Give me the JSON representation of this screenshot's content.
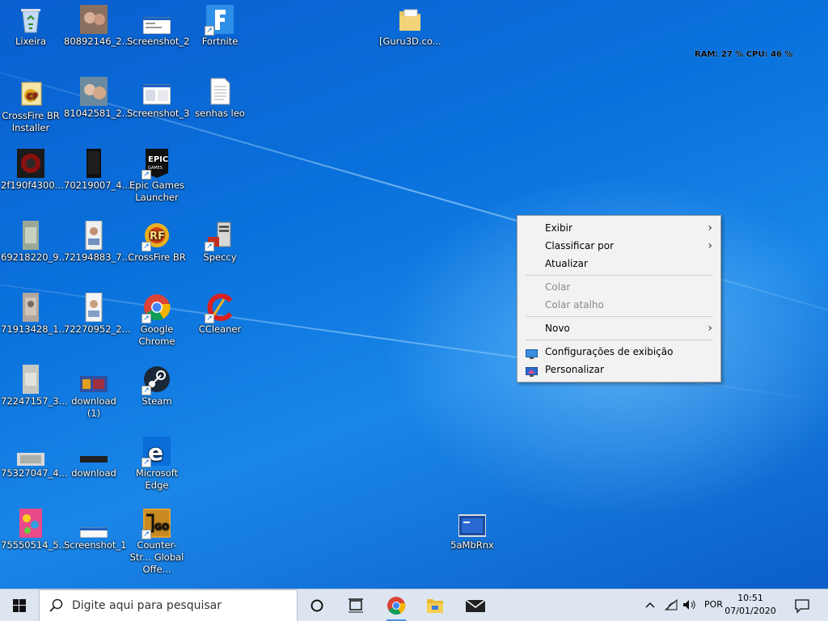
{
  "desktop_icons": [
    {
      "label": "Lixeira",
      "icon": "recycle-bin-icon"
    },
    {
      "label": "80892146_2...",
      "icon": "photo-thumbnail-icon"
    },
    {
      "label": "Screenshot_2",
      "icon": "image-file-icon"
    },
    {
      "label": "Fortnite",
      "icon": "fortnite-icon"
    },
    {
      "label": "[Guru3D.co...",
      "icon": "folder-icon"
    },
    {
      "label": "CrossFire BR Installer",
      "icon": "crossfire-installer-icon"
    },
    {
      "label": "81042581_2...",
      "icon": "photo-thumbnail-icon"
    },
    {
      "label": "Screenshot_3",
      "icon": "image-file-icon"
    },
    {
      "label": "senhas leo",
      "icon": "text-file-icon"
    },
    {
      "label": "2f190f4300...",
      "icon": "photo-thumbnail-icon"
    },
    {
      "label": "70219007_4...",
      "icon": "photo-thumbnail-icon"
    },
    {
      "label": "Epic Games Launcher",
      "icon": "epic-games-icon"
    },
    {
      "label": "69218220_9...",
      "icon": "photo-thumbnail-icon"
    },
    {
      "label": "72194883_7...",
      "icon": "photo-thumbnail-icon"
    },
    {
      "label": "CrossFire BR",
      "icon": "crossfire-icon"
    },
    {
      "label": "Speccy",
      "icon": "speccy-icon"
    },
    {
      "label": "71913428_1...",
      "icon": "photo-thumbnail-icon"
    },
    {
      "label": "72270952_2...",
      "icon": "photo-thumbnail-icon"
    },
    {
      "label": "Google Chrome",
      "icon": "chrome-icon"
    },
    {
      "label": "CCleaner",
      "icon": "ccleaner-icon"
    },
    {
      "label": "72247157_3...",
      "icon": "photo-thumbnail-icon"
    },
    {
      "label": "download (1)",
      "icon": "image-file-icon"
    },
    {
      "label": "Steam",
      "icon": "steam-icon"
    },
    {
      "label": "75327047_4...",
      "icon": "photo-thumbnail-icon"
    },
    {
      "label": "download",
      "icon": "image-file-icon"
    },
    {
      "label": "Microsoft Edge",
      "icon": "edge-icon"
    },
    {
      "label": "75550514_5...",
      "icon": "photo-thumbnail-icon"
    },
    {
      "label": "Screenshot_1",
      "icon": "image-file-icon"
    },
    {
      "label": "Counter-Str... Global Offe...",
      "icon": "csgo-icon"
    },
    {
      "label": "5aMbRnx",
      "icon": "image-file-icon"
    }
  ],
  "sysinfo": "RAM: 27 %  CPU: 46 %",
  "context_menu": {
    "items": [
      {
        "label": "Exibir"
      },
      {
        "label": "Classificar por"
      },
      {
        "label": "Atualizar"
      },
      {
        "label": "Colar"
      },
      {
        "label": "Colar atalho"
      },
      {
        "label": "Novo"
      },
      {
        "label": "Configurações de exibição"
      },
      {
        "label": "Personalizar"
      }
    ]
  },
  "taskbar": {
    "search_placeholder": "Digite aqui para pesquisar",
    "language": "POR",
    "time": "10:51",
    "date": "07/01/2020"
  }
}
